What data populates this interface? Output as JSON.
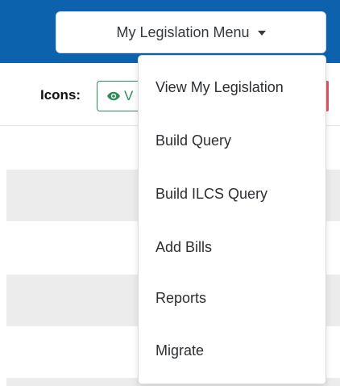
{
  "header": {
    "menu_button_label": "My Legislation Menu"
  },
  "toolbar": {
    "icons_label": "Icons:",
    "view_chip_label": "V"
  },
  "dropdown": {
    "items": [
      {
        "label": "View My Legislation"
      },
      {
        "label": "Build Query"
      },
      {
        "label": "Build ILCS Query"
      },
      {
        "label": "Add Bills"
      },
      {
        "label": "Reports"
      },
      {
        "label": "Migrate"
      }
    ]
  },
  "colors": {
    "navbar": "#0d62ae",
    "chip_green": "#2e8b57",
    "row_stripe": "#ececec",
    "edge_red": "#e05563"
  },
  "icons": {
    "menu_caret": "caret-down-icon",
    "view_chip": "eye-icon"
  }
}
